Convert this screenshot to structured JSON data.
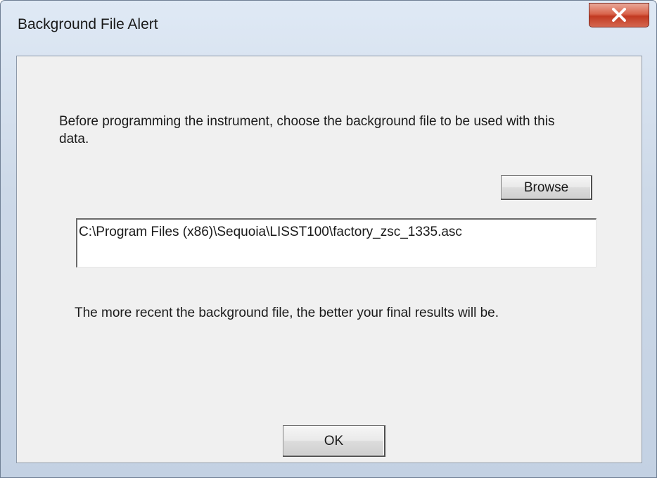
{
  "window": {
    "title": "Background File Alert",
    "close_icon": "close-x-icon",
    "close_color": "#c8402a"
  },
  "dialog": {
    "message": "Before programming the instrument, choose the background file to be used with this data.",
    "browse_label": "Browse",
    "file_path_value": "C:\\Program Files (x86)\\Sequoia\\LISST100\\factory_zsc_1335.asc",
    "hint": "The more recent the background file, the better your final results will be.",
    "ok_label": "OK"
  }
}
